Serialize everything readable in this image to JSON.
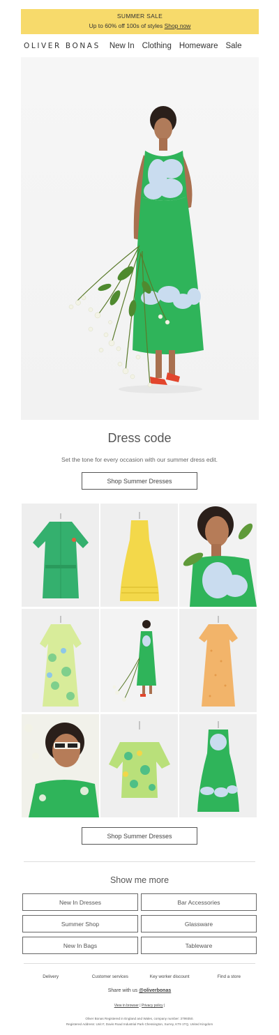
{
  "banner": {
    "line1": "SUMMER SALE",
    "line2_text": "Up to 60% off 100s of styles",
    "line2_link": "Shop now",
    "bg_color": "#f7da6b"
  },
  "nav": {
    "logo": "OLIVER BONAS",
    "items": [
      "New In",
      "Clothing",
      "Homeware",
      "Sale"
    ]
  },
  "hero": {
    "heading": "Dress code",
    "subtext": "Set the tone for every occasion with our summer dress edit.",
    "cta": "Shop Summer Dresses"
  },
  "grid_cta": "Shop Summer Dresses",
  "more": {
    "title": "Show me more",
    "buttons": [
      "New In Dresses",
      "Bar Accessories",
      "Summer Shop",
      "Glassware",
      "New In Bags",
      "Tableware"
    ]
  },
  "footer": {
    "links": [
      "Delivery",
      "Customer services",
      "Key worker discount",
      "Find a store"
    ],
    "share_prefix": "Share with us",
    "share_handle": "@oliverbonas",
    "view_in_browser": "View in browser",
    "sep1": "|",
    "privacy": "Privacy policy",
    "sep2": "|",
    "legal1": "Oliver Bonas Registered in England and Wales, company number: 3799350.",
    "legal2": "Registered Address: Unit F, Davis Road Industrial Park Chessington, Surrey, KT9 1TQ, United Kingdom"
  },
  "colors": {
    "green_dress": "#2fb45a",
    "yellow_dress": "#f3d84a",
    "orange_dress": "#f2b46a",
    "blue_flower": "#c9dcef"
  }
}
